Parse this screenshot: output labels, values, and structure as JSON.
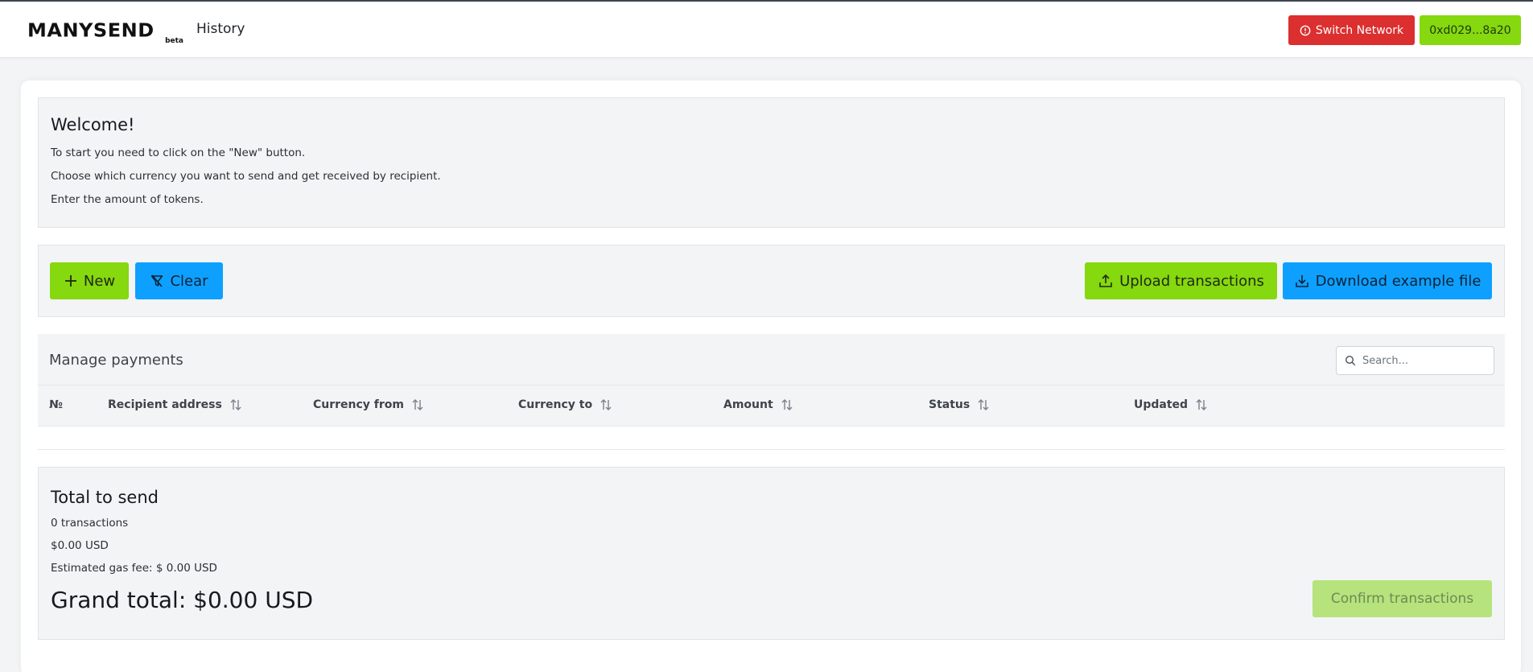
{
  "header": {
    "logo_text": "MANYSEND",
    "logo_badge": "beta",
    "nav_history": "History",
    "switch_network_label": "Switch Network",
    "wallet_address": "0xd029...8a20"
  },
  "welcome": {
    "title": "Welcome!",
    "lines": [
      "To start you need to click on the \"New\" button.",
      "Choose which currency you want to send and get received by recipient.",
      "Enter the amount of tokens."
    ]
  },
  "actions": {
    "new_label": "New",
    "clear_label": "Clear",
    "upload_label": "Upload transactions",
    "download_label": "Download example file"
  },
  "payments": {
    "title": "Manage payments",
    "search_placeholder": "Search...",
    "columns": [
      "№",
      "Recipient address",
      "Currency from",
      "Currency to",
      "Amount",
      "Status",
      "Updated"
    ],
    "rows": []
  },
  "total": {
    "title": "Total to send",
    "transactions": "0 transactions",
    "usd": "$0.00 USD",
    "gas_fee": "Estimated gas fee: $ 0.00 USD",
    "grand_total": "Grand total: $0.00 USD",
    "confirm_label": "Confirm transactions"
  },
  "colors": {
    "green": "#86d80f",
    "blue": "#0ea0ff",
    "red": "#dc2f2f",
    "confirm_disabled": "#b6e37c"
  },
  "icons": {
    "switch": "alert-circle-icon",
    "new": "plus-icon",
    "clear": "filter-off-icon",
    "upload": "upload-icon",
    "download": "download-icon",
    "search": "search-icon",
    "sort": "sort-arrows-icon"
  }
}
